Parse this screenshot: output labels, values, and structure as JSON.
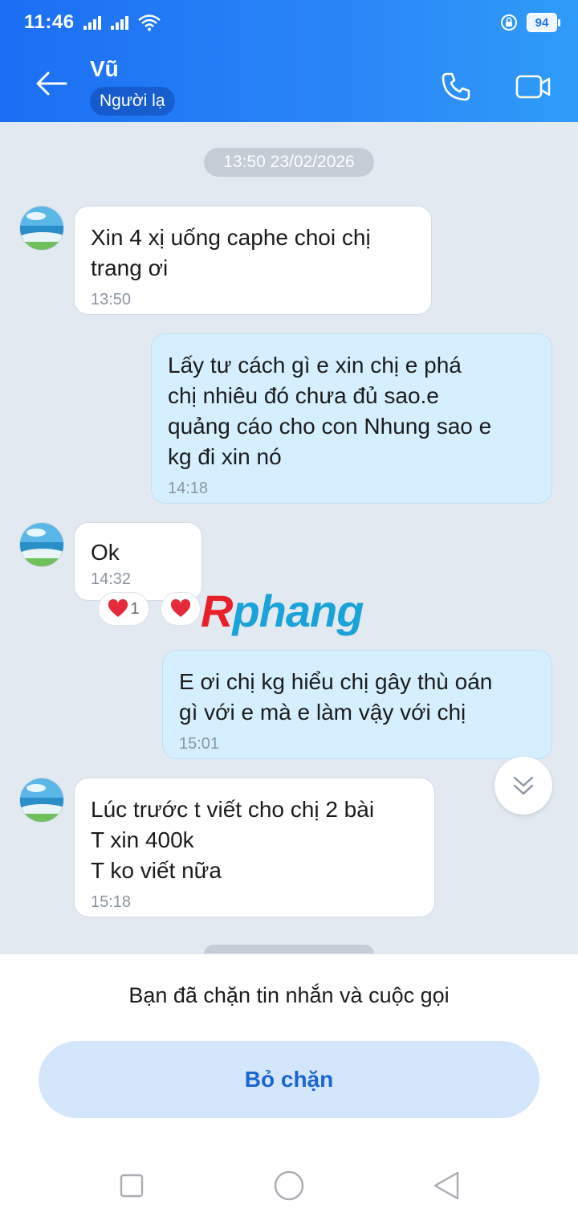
{
  "status_bar": {
    "time": "11:46",
    "battery": "94"
  },
  "header": {
    "contact_name": "Vũ",
    "contact_tag": "Người lạ"
  },
  "chat": {
    "date_separator": "13:50 23/02/2026",
    "messages": [
      {
        "direction": "incoming",
        "text": "Xin 4 xị uống caphe choi chị\ntrang ơi",
        "time": "13:50"
      },
      {
        "direction": "outgoing",
        "text": "Lấy tư cách gì e xin chị e phá\nchị nhiêu đó chưa đủ sao.e\nquảng cáo cho con Nhung sao e\nkg đi xin nó",
        "time": "14:18"
      },
      {
        "direction": "incoming",
        "text": "Ok",
        "time": "14:32",
        "reaction_count": "1"
      },
      {
        "direction": "outgoing",
        "text": "E ơi chị kg hiểu chị gây thù oán\ngì với e mà e làm vậy với chị",
        "time": "15:01"
      },
      {
        "direction": "incoming",
        "text": "Lúc trước t viết cho chị 2 bài\nT xin 400k\nT ko viết nữa",
        "time": "15:18"
      }
    ]
  },
  "watermark": {
    "first_letter": "R",
    "rest": "phang"
  },
  "block_panel": {
    "message": "Bạn đã chặn tin nhắn và cuộc gọi",
    "unblock_label": "Bỏ chặn"
  },
  "icons": {
    "back": "arrow-left-icon",
    "call": "phone-icon",
    "video": "video-camera-icon",
    "scroll": "chevron-double-down-icon",
    "heart": "heart-icon"
  },
  "colors": {
    "header_start": "#1b6ef3",
    "header_end": "#2f9cf9",
    "chat_bg": "#e2e9f1",
    "outgoing_bubble": "#d5efff",
    "unblock_bg": "#d4e6fb",
    "unblock_text": "#1a66d4"
  }
}
